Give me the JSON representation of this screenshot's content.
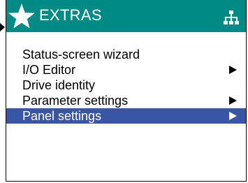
{
  "header": {
    "title": "EXTRAS",
    "icon": "star-icon",
    "right_icon": "network-tree-icon"
  },
  "menu": {
    "items": [
      {
        "label": "Status-screen wizard",
        "has_submenu": false,
        "selected": false
      },
      {
        "label": "I/O Editor",
        "has_submenu": true,
        "selected": false
      },
      {
        "label": "Drive identity",
        "has_submenu": false,
        "selected": false
      },
      {
        "label": "Parameter settings",
        "has_submenu": true,
        "selected": false
      },
      {
        "label": "Panel settings",
        "has_submenu": true,
        "selected": true
      }
    ]
  },
  "colors": {
    "header_bg": "#008a86",
    "selection_bg": "#3a54a6",
    "text": "#000000"
  }
}
